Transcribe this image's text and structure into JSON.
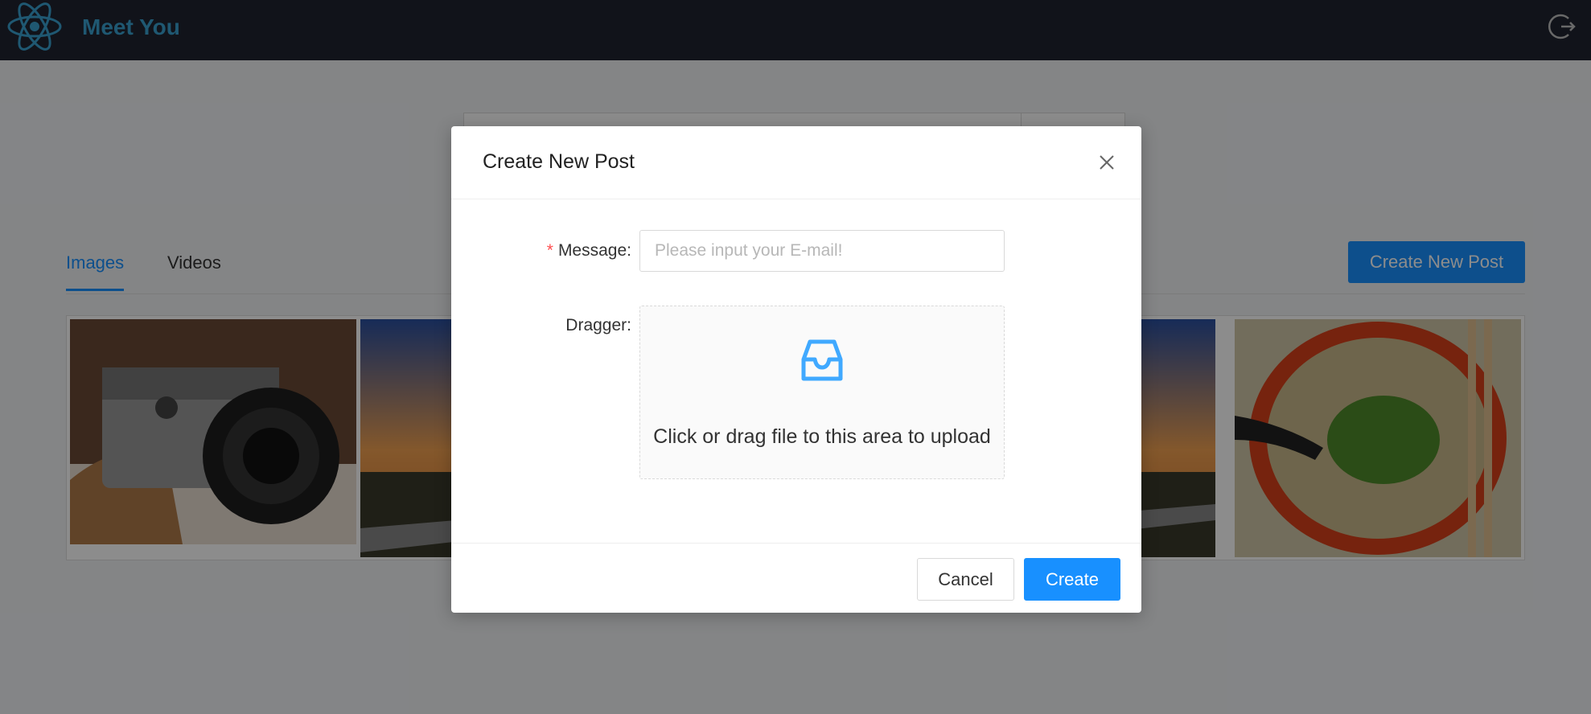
{
  "header": {
    "app_title": "Meet You",
    "logo_icon": "react-atom-logo-icon",
    "logout_icon": "logout-icon"
  },
  "tabs": [
    {
      "label": "Images",
      "active": true
    },
    {
      "label": "Videos",
      "active": false
    }
  ],
  "create_post_button": "Create New Post",
  "gallery": {
    "images": [
      "camera-photo",
      "sunset-photo",
      "sunset-photo",
      "soup-photo"
    ]
  },
  "modal": {
    "title": "Create New Post",
    "close_icon": "close-icon",
    "message_label": "Message",
    "message_required_star": "*",
    "message_label_colon": ":",
    "message_placeholder": "Please input your E-mail!",
    "message_value": "",
    "dragger_label": "Dragger",
    "dragger_label_colon": ":",
    "dragger_icon": "inbox-icon",
    "dragger_text": "Click or drag file to this area to upload",
    "cancel_label": "Cancel",
    "create_label": "Create"
  },
  "colors": {
    "header_bg": "#1f2430",
    "brand": "#3aa0cf",
    "primary": "#1890ff",
    "required": "#ff4d4f"
  }
}
